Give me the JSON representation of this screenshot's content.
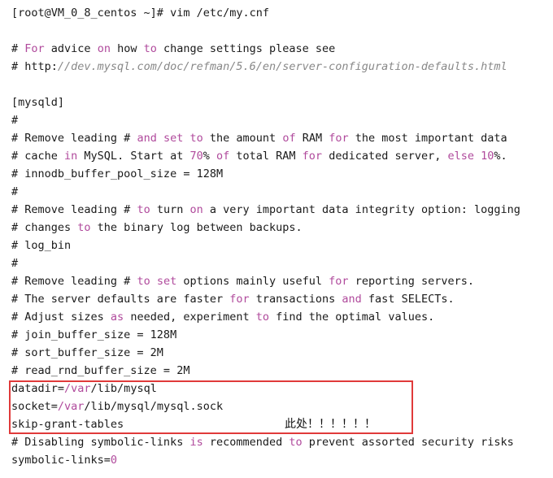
{
  "terminal": {
    "lines": [
      [
        {
          "t": "[root@VM_0_8_centos ~]# vim /etc/my.cnf"
        }
      ],
      [
        {
          "t": ""
        }
      ],
      [
        {
          "t": "# "
        },
        {
          "t": "For",
          "c": "kw"
        },
        {
          "t": " advice "
        },
        {
          "t": "on",
          "c": "kw"
        },
        {
          "t": " how "
        },
        {
          "t": "to",
          "c": "kw"
        },
        {
          "t": " change settings please see"
        }
      ],
      [
        {
          "t": "# http:"
        },
        {
          "t": "//dev.mysql.com/doc/refman/5.6/en/server-configuration-defaults.html",
          "c": "url"
        }
      ],
      [
        {
          "t": ""
        }
      ],
      [
        {
          "t": "[mysqld]"
        }
      ],
      [
        {
          "t": "#"
        }
      ],
      [
        {
          "t": "# Remove leading # "
        },
        {
          "t": "and",
          "c": "kw"
        },
        {
          "t": " "
        },
        {
          "t": "set",
          "c": "kw"
        },
        {
          "t": " "
        },
        {
          "t": "to",
          "c": "kw"
        },
        {
          "t": " the amount "
        },
        {
          "t": "of",
          "c": "kw"
        },
        {
          "t": " RAM "
        },
        {
          "t": "for",
          "c": "kw"
        },
        {
          "t": " the most important data"
        }
      ],
      [
        {
          "t": "# cache "
        },
        {
          "t": "in",
          "c": "kw"
        },
        {
          "t": " MySQL. Start at "
        },
        {
          "t": "70",
          "c": "num"
        },
        {
          "t": "% "
        },
        {
          "t": "of",
          "c": "kw"
        },
        {
          "t": " total RAM "
        },
        {
          "t": "for",
          "c": "kw"
        },
        {
          "t": " dedicated server, "
        },
        {
          "t": "else",
          "c": "kw"
        },
        {
          "t": " "
        },
        {
          "t": "10",
          "c": "num"
        },
        {
          "t": "%."
        }
      ],
      [
        {
          "t": "# innodb_buffer_pool_size = 128M"
        }
      ],
      [
        {
          "t": "#"
        }
      ],
      [
        {
          "t": "# Remove leading # "
        },
        {
          "t": "to",
          "c": "kw"
        },
        {
          "t": " turn "
        },
        {
          "t": "on",
          "c": "kw"
        },
        {
          "t": " a very important data integrity option: logging"
        }
      ],
      [
        {
          "t": "# changes "
        },
        {
          "t": "to",
          "c": "kw"
        },
        {
          "t": " the binary log between backups."
        }
      ],
      [
        {
          "t": "# log_bin"
        }
      ],
      [
        {
          "t": "#"
        }
      ],
      [
        {
          "t": "# Remove leading # "
        },
        {
          "t": "to",
          "c": "kw"
        },
        {
          "t": " "
        },
        {
          "t": "set",
          "c": "kw"
        },
        {
          "t": " options mainly useful "
        },
        {
          "t": "for",
          "c": "kw"
        },
        {
          "t": " reporting servers."
        }
      ],
      [
        {
          "t": "# The server defaults are faster "
        },
        {
          "t": "for",
          "c": "kw"
        },
        {
          "t": " transactions "
        },
        {
          "t": "and",
          "c": "kw"
        },
        {
          "t": " fast SELECTs."
        }
      ],
      [
        {
          "t": "# Adjust sizes "
        },
        {
          "t": "as",
          "c": "kw"
        },
        {
          "t": " needed, experiment "
        },
        {
          "t": "to",
          "c": "kw"
        },
        {
          "t": " find the optimal values."
        }
      ],
      [
        {
          "t": "# join_buffer_size = 128M"
        }
      ],
      [
        {
          "t": "# sort_buffer_size = 2M"
        }
      ],
      [
        {
          "t": "# read_rnd_buffer_size = 2M"
        }
      ],
      [
        {
          "t": "datadir="
        },
        {
          "t": "/var",
          "c": "kw"
        },
        {
          "t": "/lib/mysql"
        }
      ],
      [
        {
          "t": "socket="
        },
        {
          "t": "/var",
          "c": "kw"
        },
        {
          "t": "/lib/mysql/mysql.sock"
        }
      ],
      [
        {
          "t": "skip-grant-tables"
        }
      ],
      [
        {
          "t": "# Disabling symbolic-links "
        },
        {
          "t": "is",
          "c": "kw"
        },
        {
          "t": " recommended "
        },
        {
          "t": "to",
          "c": "kw"
        },
        {
          "t": " prevent assorted security risks"
        }
      ],
      [
        {
          "t": "symbolic-links="
        },
        {
          "t": "0",
          "c": "num"
        }
      ]
    ]
  },
  "annotation": {
    "text": "此处！！！！！！"
  },
  "colors": {
    "keyword": "#b04a9c",
    "url": "#888888",
    "text": "#1a1a1a",
    "highlight_border": "#e03a3a",
    "background": "#ffffff"
  }
}
